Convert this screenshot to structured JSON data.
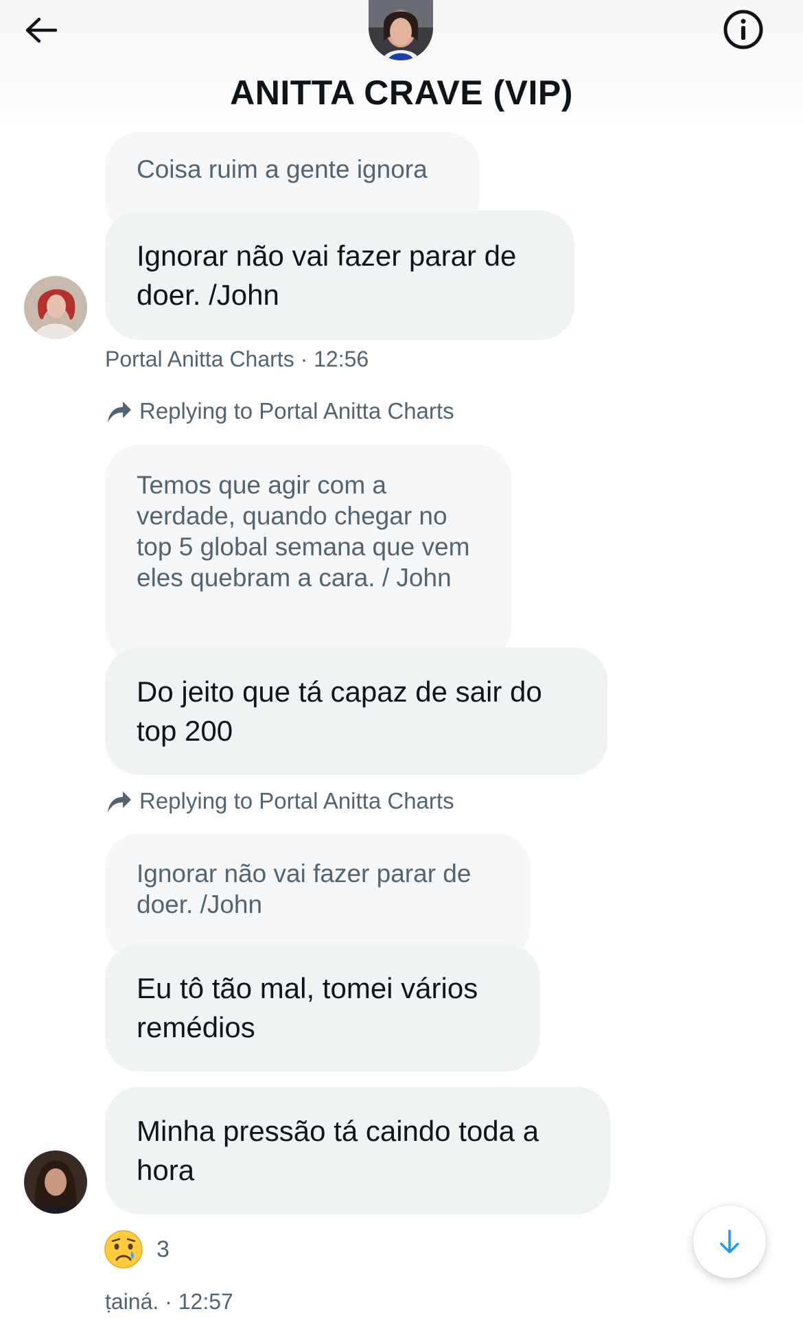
{
  "header": {
    "title": "ANITTA CRAVE (VIP)",
    "back_icon": "arrow-left-icon",
    "info_icon": "info-circle-icon"
  },
  "messages": [
    {
      "quoted": "Coisa ruim a gente ignora",
      "text": "Ignorar não vai fazer parar de doer. /John",
      "meta": "Portal Anitta Charts · 12:56"
    },
    {
      "reply_to": "Replying to Portal Anitta Charts",
      "quoted": "Temos que agir com a verdade, quando chegar no top 5 global semana que vem eles quebram a cara. / John",
      "text": "Do jeito que tá capaz de sair do top 200"
    },
    {
      "reply_to": "Replying to Portal Anitta Charts",
      "quoted": "Ignorar não vai fazer parar de doer. /John",
      "text": "Eu tô tão mal, tomei vários remédios"
    },
    {
      "text": "Minha pressão tá caindo toda a hora",
      "reaction": {
        "emoji": "😢",
        "count": "3"
      },
      "meta": "ṭainá. · 12:57"
    }
  ],
  "colors": {
    "bubble": "#eff3f4",
    "quoted_bubble": "#f6f7f9",
    "secondary_text": "#536471",
    "accent": "#1d9bf0"
  }
}
